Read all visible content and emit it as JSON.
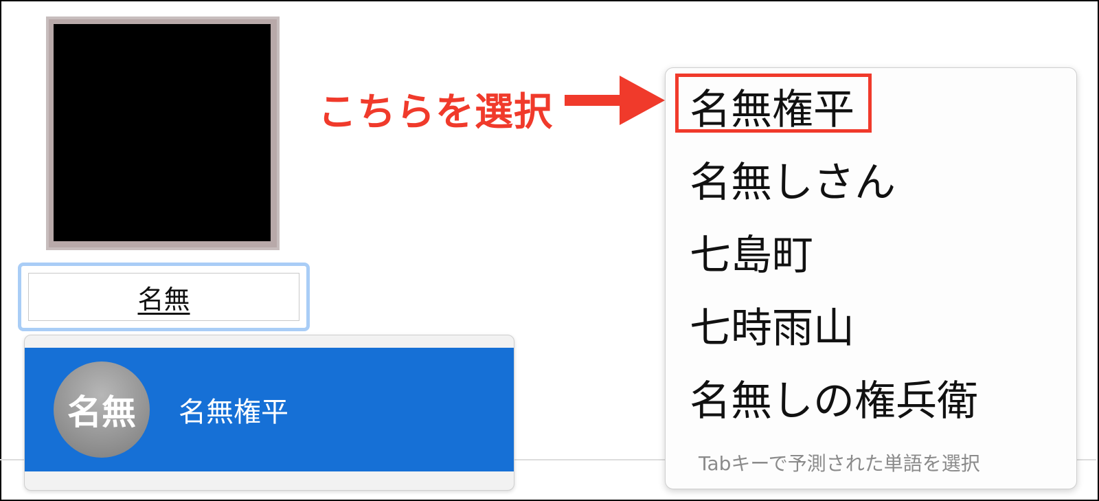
{
  "name_field": {
    "value": "名無"
  },
  "autocomplete": {
    "avatar_text": "名無",
    "suggestion_label": "名無権平",
    "highlight_color": "#1670d6"
  },
  "annotation": {
    "text": "こちらを選択",
    "color": "#f03a2b"
  },
  "ime_candidates": {
    "items": [
      "名無権平",
      "名無しさん",
      "七島町",
      "七時雨山",
      "名無しの権兵衛"
    ],
    "hint": "Tabキーで予測された単語を選択"
  },
  "icons": {
    "arrow": "arrow-right-icon"
  }
}
